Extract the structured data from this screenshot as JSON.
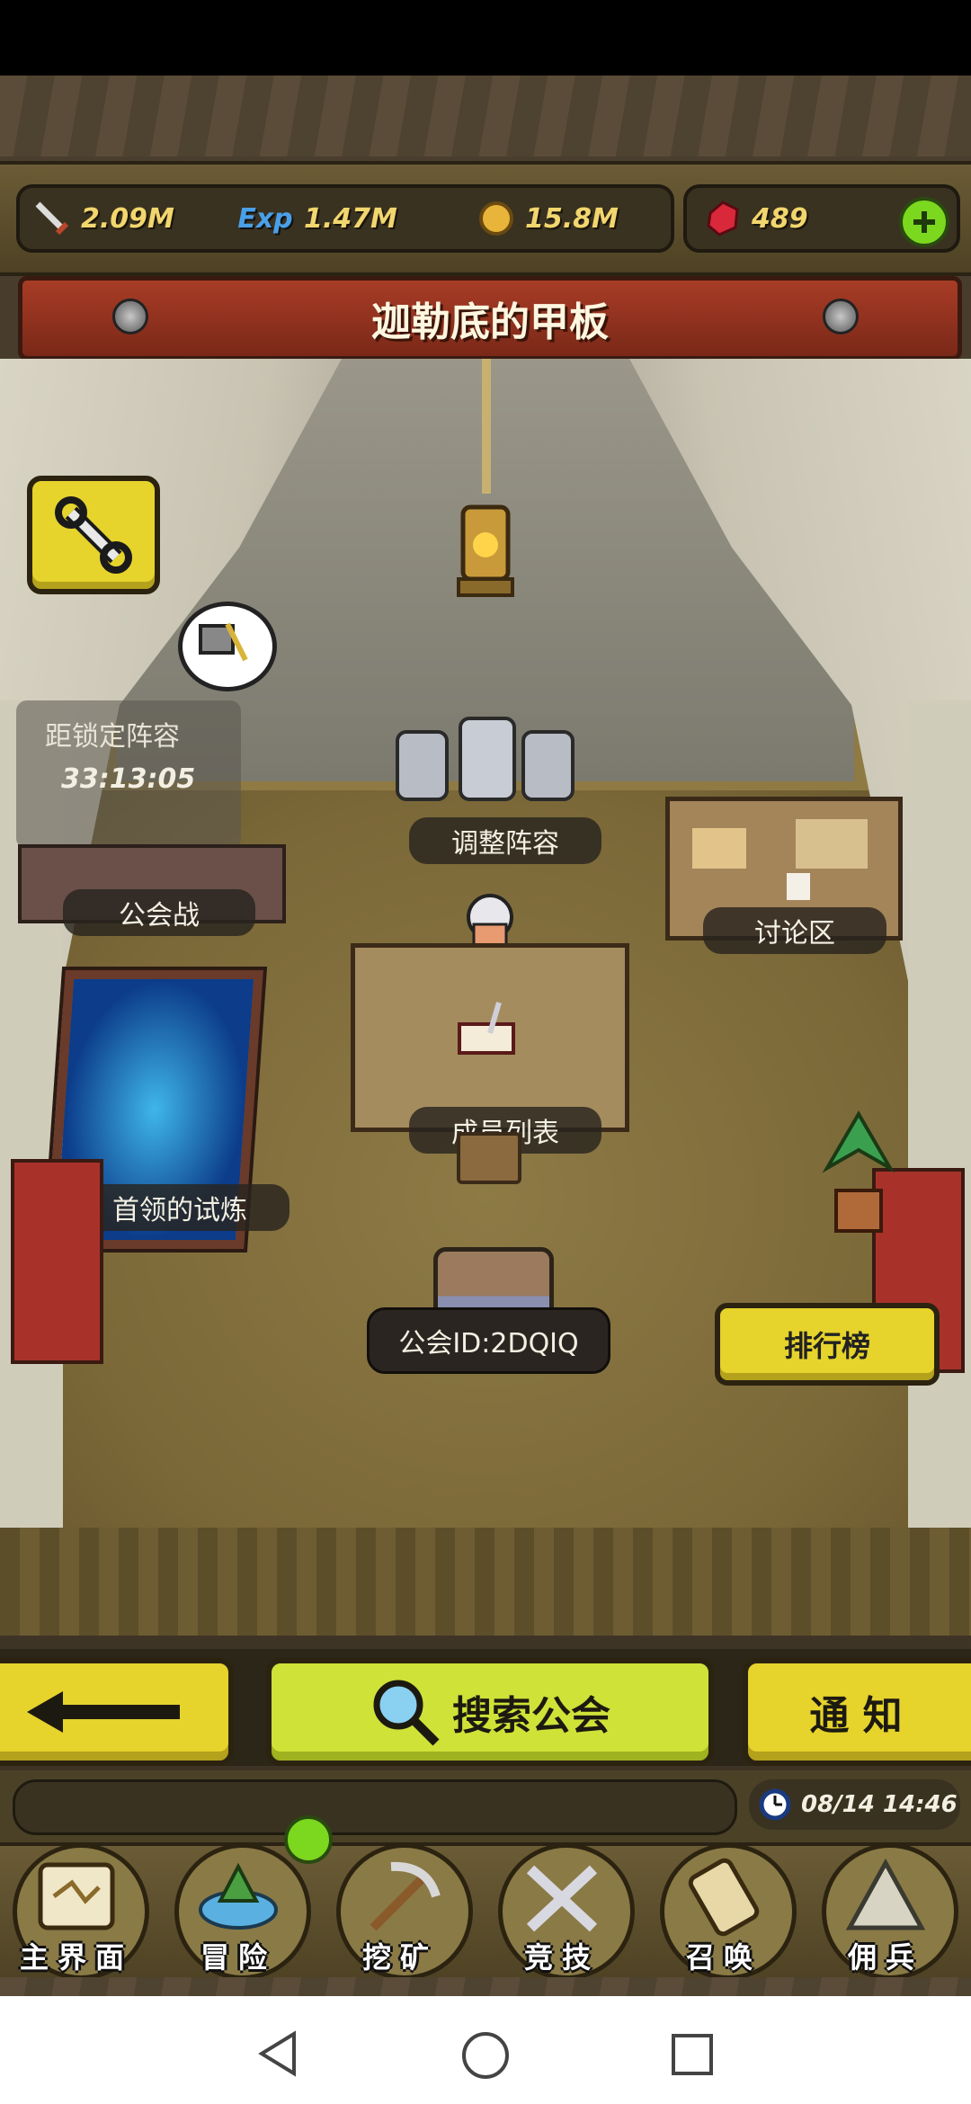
{
  "resources": {
    "power": "2.09M",
    "exp_icon": "Exp",
    "exp": "1.47M",
    "gold": "15.8M",
    "gems": "489"
  },
  "location_title": "迦勒底的甲板",
  "scene": {
    "lock_title": "距锁定阵容",
    "lock_timer": "33:13:05",
    "adjust_lineup": "调整阵容",
    "discussion": "讨论区",
    "guild_war": "公会战",
    "member_list": "成员列表",
    "leader_trial": "首领的试炼",
    "guild_id": "公会ID:2DQIQ",
    "ranking": "排行榜"
  },
  "actions": {
    "search_guild": "搜索公会",
    "notice": "通 知"
  },
  "clock": "08/14 14:46",
  "nav": [
    {
      "label": "主界面",
      "icon": "map-scroll-icon"
    },
    {
      "label": "冒险",
      "icon": "island-icon"
    },
    {
      "label": "挖矿",
      "icon": "pickaxe-icon"
    },
    {
      "label": "竞技",
      "icon": "crossed-swords-icon"
    },
    {
      "label": "召唤",
      "icon": "summon-scroll-icon"
    },
    {
      "label": "佣兵",
      "icon": "tent-icon"
    }
  ],
  "colors": {
    "accent_yellow": "#e6d32c",
    "banner_red": "#a83c26",
    "search_green": "#cfe238",
    "notification_green": "#7bd81e"
  }
}
